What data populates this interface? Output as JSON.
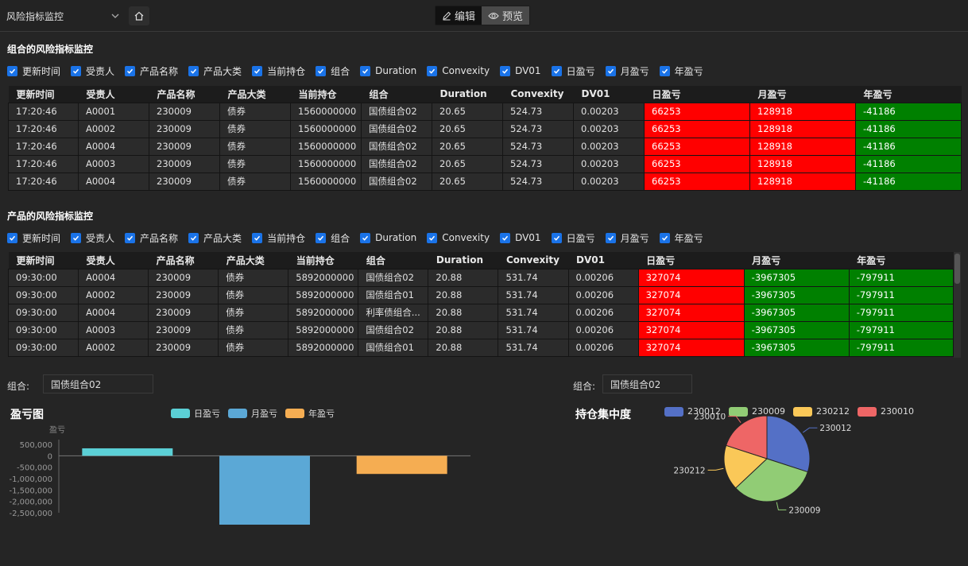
{
  "topbar": {
    "dashboard_name": "风险指标监控",
    "edit_label": "编辑",
    "preview_label": "预览"
  },
  "portfolio_section": {
    "title": "组合的风险指标监控",
    "filters": [
      "更新时间",
      "受责人",
      "产品名称",
      "产品大类",
      "当前持仓",
      "组合",
      "Duration",
      "Convexity",
      "DV01",
      "日盈亏",
      "月盈亏",
      "年盈亏"
    ],
    "columns": [
      "更新时间",
      "受责人",
      "产品名称",
      "产品大类",
      "当前持仓",
      "组合",
      "Duration",
      "Convexity",
      "DV01",
      "日盈亏",
      "月盈亏",
      "年盈亏"
    ],
    "rows": [
      [
        "17:20:46",
        "A0001",
        "230009",
        "债券",
        "1560000000",
        "国债组合02",
        "20.65",
        "524.73",
        "0.00203",
        "66253",
        "128918",
        "-41186"
      ],
      [
        "17:20:46",
        "A0002",
        "230009",
        "债券",
        "1560000000",
        "国债组合02",
        "20.65",
        "524.73",
        "0.00203",
        "66253",
        "128918",
        "-41186"
      ],
      [
        "17:20:46",
        "A0004",
        "230009",
        "债券",
        "1560000000",
        "国债组合02",
        "20.65",
        "524.73",
        "0.00203",
        "66253",
        "128918",
        "-41186"
      ],
      [
        "17:20:46",
        "A0003",
        "230009",
        "债券",
        "1560000000",
        "国债组合02",
        "20.65",
        "524.73",
        "0.00203",
        "66253",
        "128918",
        "-41186"
      ],
      [
        "17:20:46",
        "A0004",
        "230009",
        "债券",
        "1560000000",
        "国债组合02",
        "20.65",
        "524.73",
        "0.00203",
        "66253",
        "128918",
        "-41186"
      ]
    ]
  },
  "product_section": {
    "title": "产品的风险指标监控",
    "filters": [
      "更新时间",
      "受责人",
      "产品名称",
      "产品大类",
      "当前持仓",
      "组合",
      "Duration",
      "Convexity",
      "DV01",
      "日盈亏",
      "月盈亏",
      "年盈亏"
    ],
    "columns": [
      "更新时间",
      "受责人",
      "产品名称",
      "产品大类",
      "当前持仓",
      "组合",
      "Duration",
      "Convexity",
      "DV01",
      "日盈亏",
      "月盈亏",
      "年盈亏"
    ],
    "rows": [
      [
        "09:30:00",
        "A0004",
        "230009",
        "债券",
        "5892000000",
        "国债组合02",
        "20.88",
        "531.74",
        "0.00206",
        "327074",
        "-3967305",
        "-797911"
      ],
      [
        "09:30:00",
        "A0002",
        "230009",
        "债券",
        "5892000000",
        "国债组合01",
        "20.88",
        "531.74",
        "0.00206",
        "327074",
        "-3967305",
        "-797911"
      ],
      [
        "09:30:00",
        "A0004",
        "230009",
        "债券",
        "5892000000",
        "利率债组合...",
        "20.88",
        "531.74",
        "0.00206",
        "327074",
        "-3967305",
        "-797911"
      ],
      [
        "09:30:00",
        "A0003",
        "230009",
        "债券",
        "5892000000",
        "国债组合02",
        "20.88",
        "531.74",
        "0.00206",
        "327074",
        "-3967305",
        "-797911"
      ],
      [
        "09:30:00",
        "A0002",
        "230009",
        "债券",
        "5892000000",
        "国债组合01",
        "20.88",
        "531.74",
        "0.00206",
        "327074",
        "-3967305",
        "-797911"
      ]
    ]
  },
  "pnl_panel": {
    "combo_label": "组合:",
    "combo_value": "国债组合02"
  },
  "holding_panel": {
    "combo_label": "组合:",
    "combo_value": "国债组合02"
  },
  "colors": {
    "positive_cell": "#ff0000",
    "negative_cell": "#008000",
    "checkbox": "#1a73e8"
  },
  "chart_data": [
    {
      "type": "bar",
      "title": "盈亏图",
      "ylabel": "盈亏",
      "categories": [
        "日盈亏",
        "月盈亏",
        "年盈亏"
      ],
      "series": [
        {
          "name": "日盈亏",
          "color": "#5bd0d6",
          "values": [
            327074
          ]
        },
        {
          "name": "月盈亏",
          "color": "#5ba8d6",
          "values": [
            -3967305
          ]
        },
        {
          "name": "年盈亏",
          "color": "#f5ad52",
          "values": [
            -797911
          ]
        }
      ],
      "yticks": [
        "500,000",
        "0",
        "-500,000",
        "-1,000,000",
        "-1,500,000",
        "-2,000,000",
        "-2,500,000"
      ],
      "ylim": [
        -2500000,
        500000
      ],
      "legend": "top"
    },
    {
      "type": "pie",
      "title": "持仓集中度",
      "labels": [
        "230012",
        "230009",
        "230212",
        "230010"
      ],
      "values": [
        30,
        33,
        17,
        20
      ],
      "colors": [
        "#5470c6",
        "#91cc75",
        "#fac858",
        "#ee6666"
      ],
      "legend": "top"
    }
  ]
}
